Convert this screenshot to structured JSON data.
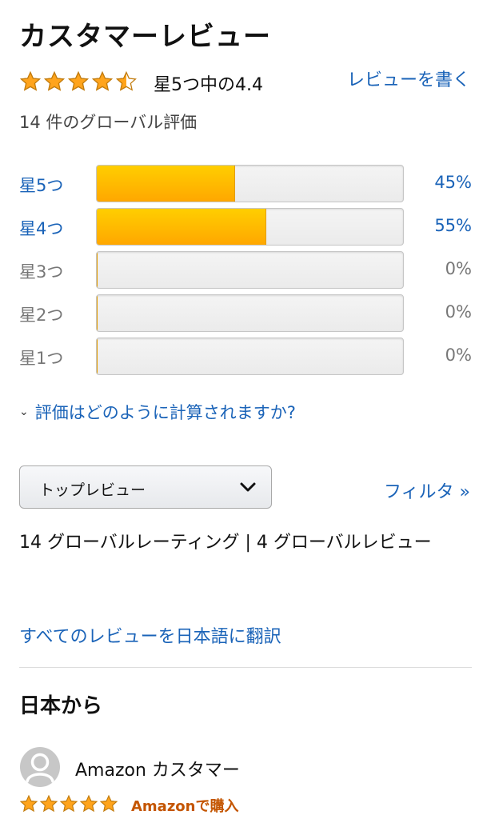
{
  "header": {
    "title": "カスタマーレビュー",
    "rating_text": "星5つ中の4.4",
    "stars_value": 4.4,
    "write_review": "レビューを書く",
    "global_ratings": "14 件のグローバル評価"
  },
  "histogram": [
    {
      "label": "星5つ",
      "percent": "45%",
      "fill": 0.45,
      "active": true
    },
    {
      "label": "星4つ",
      "percent": "55%",
      "fill": 0.55,
      "active": true
    },
    {
      "label": "星3つ",
      "percent": "0%",
      "fill": 0,
      "active": false
    },
    {
      "label": "星2つ",
      "percent": "0%",
      "fill": 0,
      "active": false
    },
    {
      "label": "星1つ",
      "percent": "0%",
      "fill": 0,
      "active": false
    }
  ],
  "calc_link": "評価はどのように計算されますか?",
  "sort": {
    "selected": "トップレビュー"
  },
  "filter_link": "フィルタ »",
  "summary": "14 グローバルレーティング | 4 グローバルレビュー",
  "translate_link": "すべてのレビューを日本語に翻訳",
  "region_heading": "日本から",
  "review": {
    "author": "Amazon カスタマー",
    "stars_value": 5,
    "badge": "Amazonで購入"
  },
  "colors": {
    "link": "#1a63b8",
    "star": "#ffa41c",
    "bar_fill": "#ffb300",
    "badge": "#c45500"
  }
}
